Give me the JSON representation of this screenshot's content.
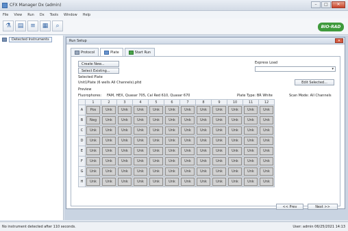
{
  "window": {
    "title": "CFX Manager Dx (admin)",
    "controls": [
      "–",
      "□",
      "✕"
    ]
  },
  "menu": [
    "File",
    "View",
    "Run",
    "Dx",
    "Tools",
    "Window",
    "Help"
  ],
  "toolbar": {
    "icons": [
      "flask-icon",
      "document-icon",
      "tubes-icon",
      "plate-icon",
      "magnifier-icon"
    ],
    "logo": "BIO-RAD"
  },
  "left_panel": {
    "tree_item": "Detected Instruments"
  },
  "dialog": {
    "title": "Run Setup",
    "close": "✕",
    "tabs": [
      {
        "label": "Protocol",
        "icon": "protocol-icon"
      },
      {
        "label": "Plate",
        "icon": "plate-icon"
      },
      {
        "label": "Start Run",
        "icon": "run-icon"
      }
    ],
    "create_new_label": "Create New...",
    "select_existing_label": "Select Existing...",
    "selected_plate_label": "Selected Plate",
    "plate_file": "Unit1Plate (6 wells All Channels).pltd",
    "express_load_label": "Express Load",
    "express_load_value": "",
    "edit_selected_label": "Edit Selected...",
    "preview_label": "Preview",
    "fluorophores": "Fluorophores:",
    "fluorophores_value": "FAM, HEX, Quasar 705, Cal Red 610, Quasar 670",
    "plate_type": "Plate Type: BR White",
    "scan_mode": "Scan Mode: All Channels",
    "columns": [
      "1",
      "2",
      "3",
      "4",
      "5",
      "6",
      "7",
      "8",
      "9",
      "10",
      "11",
      "12"
    ],
    "rows": [
      {
        "label": "A",
        "wells": [
          "Pos",
          "Unk",
          "Unk",
          "Unk",
          "Unk",
          "Unk",
          "Unk",
          "Unk",
          "Unk",
          "Unk",
          "Unk",
          "Unk"
        ]
      },
      {
        "label": "B",
        "wells": [
          "Neg",
          "Unk",
          "Unk",
          "Unk",
          "Unk",
          "Unk",
          "Unk",
          "Unk",
          "Unk",
          "Unk",
          "Unk",
          "Unk"
        ]
      },
      {
        "label": "C",
        "wells": [
          "Unk",
          "Unk",
          "Unk",
          "Unk",
          "Unk",
          "Unk",
          "Unk",
          "Unk",
          "Unk",
          "Unk",
          "Unk",
          "Unk"
        ]
      },
      {
        "label": "D",
        "wells": [
          "Unk",
          "Unk",
          "Unk",
          "Unk",
          "Unk",
          "Unk",
          "Unk",
          "Unk",
          "Unk",
          "Unk",
          "Unk",
          "Unk"
        ]
      },
      {
        "label": "E",
        "wells": [
          "Unk",
          "Unk",
          "Unk",
          "Unk",
          "Unk",
          "Unk",
          "Unk",
          "Unk",
          "Unk",
          "Unk",
          "Unk",
          "Unk"
        ]
      },
      {
        "label": "F",
        "wells": [
          "Unk",
          "Unk",
          "Unk",
          "Unk",
          "Unk",
          "Unk",
          "Unk",
          "Unk",
          "Unk",
          "Unk",
          "Unk",
          "Unk"
        ]
      },
      {
        "label": "G",
        "wells": [
          "Unk",
          "Unk",
          "Unk",
          "Unk",
          "Unk",
          "Unk",
          "Unk",
          "Unk",
          "Unk",
          "Unk",
          "Unk",
          "Unk"
        ]
      },
      {
        "label": "H",
        "wells": [
          "Unk",
          "Unk",
          "Unk",
          "Unk",
          "Unk",
          "Unk",
          "Unk",
          "Unk",
          "Unk",
          "Unk",
          "Unk",
          "Unk"
        ]
      }
    ],
    "prev_label": "<< Prev",
    "next_label": "Next >>"
  },
  "status": {
    "left": "No instrument detected after 110 seconds.",
    "right": "User: admin   06/25/2021 14:13"
  }
}
